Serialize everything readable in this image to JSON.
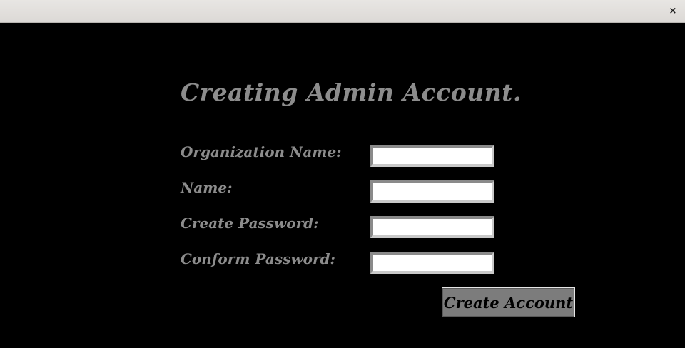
{
  "window": {
    "close_icon": "×"
  },
  "form": {
    "heading": "Creating Admin Account.",
    "fields": [
      {
        "label": "Organization Name:",
        "value": ""
      },
      {
        "label": "Name:",
        "value": ""
      },
      {
        "label": "Create Password:",
        "value": ""
      },
      {
        "label": "Conform Password:",
        "value": ""
      }
    ],
    "submit_label": "Create Account"
  },
  "colors": {
    "background": "#000000",
    "label_text": "#8c8c8c",
    "button_bg": "#7c7c7c",
    "titlebar": "#e0dedb"
  }
}
